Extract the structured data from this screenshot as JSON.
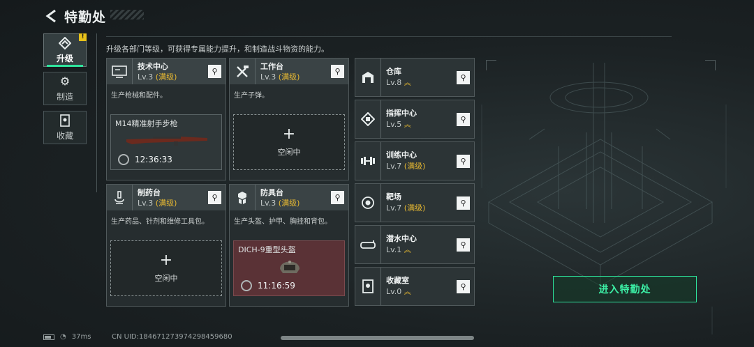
{
  "header": {
    "title": "特勤处",
    "back_icon": "back-arrow-icon"
  },
  "tabs": [
    {
      "label": "升级",
      "icon": "upgrade-icon",
      "active": true,
      "badge": "!"
    },
    {
      "label": "制造",
      "icon": "gears-icon",
      "active": false
    },
    {
      "label": "收藏",
      "icon": "collection-icon",
      "active": false
    }
  ],
  "description": "升级各部门等级，可获得专属能力提升，和制造战斗物资的能力。",
  "cards": [
    {
      "name": "技术中心",
      "level": "Lv.3",
      "max": "(满级)",
      "desc": "生产枪械和配件。",
      "icon": "monitor-icon",
      "production": {
        "item": "M14精准射手步枪",
        "time": "12:36:33",
        "style": "gray"
      }
    },
    {
      "name": "工作台",
      "level": "Lv.3",
      "max": "(满级)",
      "desc": "生产子弹。",
      "icon": "tools-icon",
      "idle": "空闲中"
    },
    {
      "name": "制药台",
      "level": "Lv.3",
      "max": "(满级)",
      "desc": "生产药品、针剂和维修工具包。",
      "icon": "microscope-icon",
      "idle": "空闲中"
    },
    {
      "name": "防具台",
      "level": "Lv.3",
      "max": "(满级)",
      "desc": "生产头盔、护甲、胸挂和背包。",
      "icon": "armor-icon",
      "production": {
        "item": "DICH-9重型头盔",
        "time": "11:16:59",
        "style": "red"
      }
    }
  ],
  "facilities": [
    {
      "name": "仓库",
      "level": "Lv.8",
      "max": "",
      "icon": "warehouse-icon"
    },
    {
      "name": "指挥中心",
      "level": "Lv.5",
      "max": "",
      "icon": "command-icon"
    },
    {
      "name": "训练中心",
      "level": "Lv.7",
      "max": "(满级)",
      "icon": "dumbbell-icon"
    },
    {
      "name": "靶场",
      "level": "Lv.7",
      "max": "(满级)",
      "icon": "target-icon"
    },
    {
      "name": "潜水中心",
      "level": "Lv.1",
      "max": "",
      "icon": "diving-mask-icon"
    },
    {
      "name": "收藏室",
      "level": "Lv.0",
      "max": "",
      "icon": "collection-room-icon"
    }
  ],
  "enter_button": "进入特勤处",
  "status": {
    "ping": "37ms",
    "uid": "CN UID:184671273974298459680"
  },
  "colors": {
    "accent": "#2ee59d",
    "gold": "#e6b832"
  }
}
